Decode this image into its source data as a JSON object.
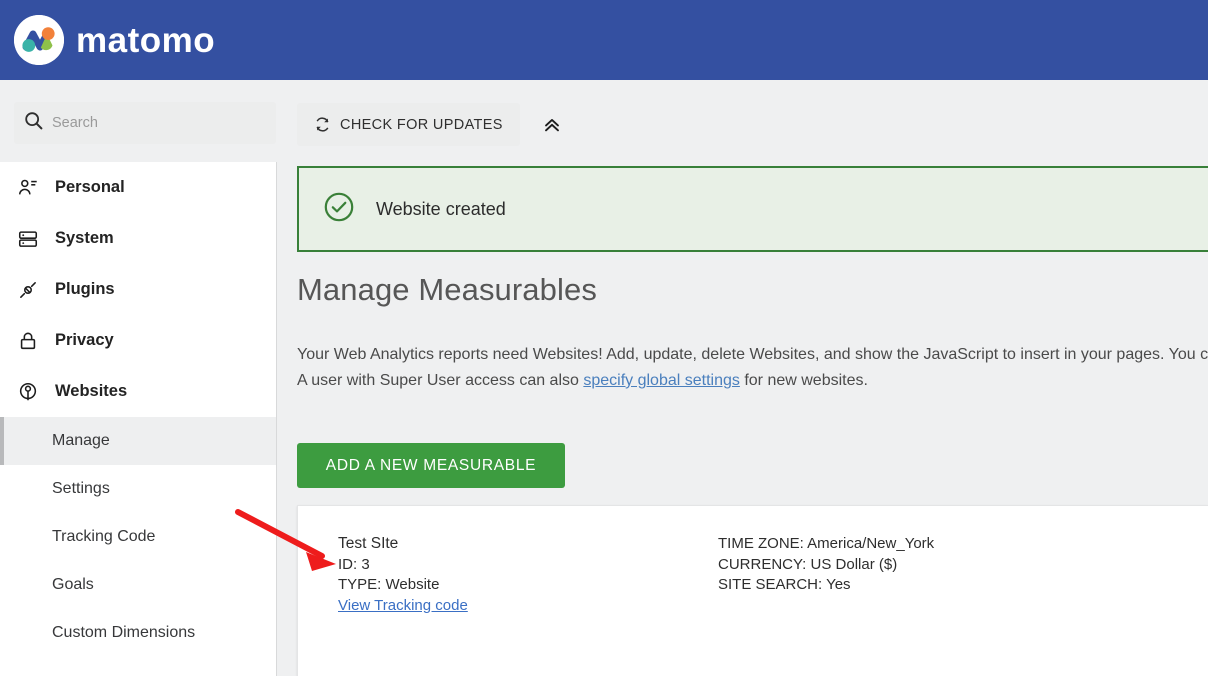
{
  "brand": {
    "name": "matomo",
    "logo_icon": "matomo-logo-icon",
    "header_color": "#3450a1"
  },
  "search": {
    "placeholder": "Search",
    "value": "",
    "icon": "search-icon"
  },
  "toolbar": {
    "check_updates_label": "CHECK FOR UPDATES",
    "check_updates_icon": "refresh-icon",
    "collapse_icon": "double-chevron-up-icon"
  },
  "sidebar": {
    "sections": [
      {
        "label": "Personal",
        "icon": "person-icon"
      },
      {
        "label": "System",
        "icon": "server-icon"
      },
      {
        "label": "Plugins",
        "icon": "plug-icon"
      },
      {
        "label": "Privacy",
        "icon": "lock-icon"
      },
      {
        "label": "Websites",
        "icon": "globe-icon"
      }
    ],
    "sub_items": [
      {
        "label": "Manage",
        "active": true
      },
      {
        "label": "Settings",
        "active": false
      },
      {
        "label": "Tracking Code",
        "active": false
      },
      {
        "label": "Goals",
        "active": false
      },
      {
        "label": "Custom Dimensions",
        "active": false
      }
    ]
  },
  "notification": {
    "message": "Website created",
    "icon": "check-circle-icon",
    "border_color": "#388039",
    "background_color": "#e8f0e6"
  },
  "main": {
    "title": "Manage Measurables",
    "description_line1_a": "Your Web Analytics reports need Websites! Add, update, delete Websites, and show the JavaScript to insert in your pages. You c",
    "description_line2_a": "A user with Super User access can also ",
    "description_link": "specify global settings",
    "description_line2_b": " for new websites.",
    "add_button_label": "ADD A NEW MEASURABLE",
    "add_button_color": "#3d9c40"
  },
  "site_card": {
    "name": "Test SIte",
    "id": "ID: 3",
    "type": "TYPE: Website",
    "tracking_link": "View Tracking code",
    "time_zone": "TIME ZONE: America/New_York",
    "currency": "CURRENCY: US Dollar ($)",
    "site_search": "SITE SEARCH: Yes"
  },
  "annotation": {
    "arrow_color": "#ee1c1c"
  }
}
